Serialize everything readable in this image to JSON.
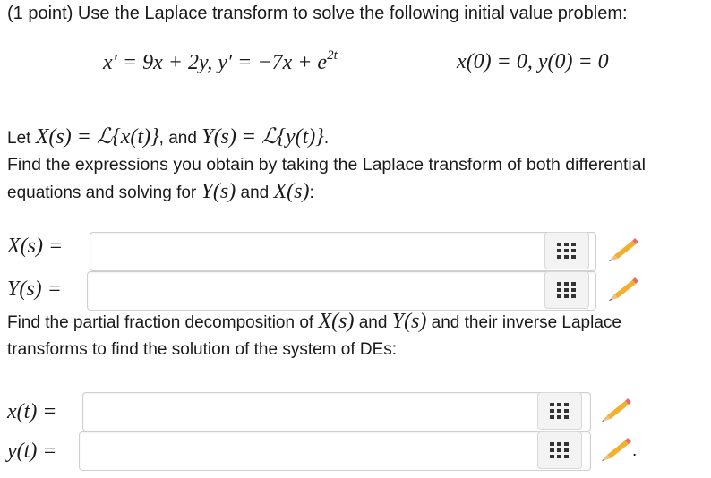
{
  "problem": {
    "header": "(1 point) Use the Laplace transform to solve the following initial value problem:",
    "eq_left": "x′ = 9x + 2y,  y′ = −7x + e",
    "eq_left_exp": "2t",
    "eq_right": "x(0) = 0,  y(0) = 0"
  },
  "intro": {
    "let_prefix": "Let",
    "let_x": "X(s) = ℒ{x(t)}",
    "let_and": ", and",
    "let_y": "Y(s) = ℒ{y(t)}",
    "let_end": ".",
    "line2": "Find the expressions you obtain by taking the Laplace transform of both differential",
    "line3_prefix": "equations and solving for",
    "line3_Y": "Y(s)",
    "line3_and": "and",
    "line3_X": "X(s)",
    "line3_end": ":"
  },
  "answers1": [
    {
      "label": "X(s) =",
      "value": "",
      "placeholder": ""
    },
    {
      "label": "Y(s) =",
      "value": "",
      "placeholder": ""
    }
  ],
  "middle": {
    "line1_prefix": "Find the partial fraction decomposition of",
    "line1_X": "X(s)",
    "line1_and": "and",
    "line1_Y": "Y(s)",
    "line1_suffix": "and their inverse Laplace",
    "line2": "transforms to find the solution of the system of DEs:"
  },
  "answers2": [
    {
      "label": "x(t) =",
      "value": "",
      "placeholder": ""
    },
    {
      "label": "y(t) =",
      "value": "",
      "placeholder": ""
    }
  ],
  "trailing_period": ".",
  "icons": {
    "palette": "equation-grid-icon",
    "edit": "pencil-icon"
  }
}
